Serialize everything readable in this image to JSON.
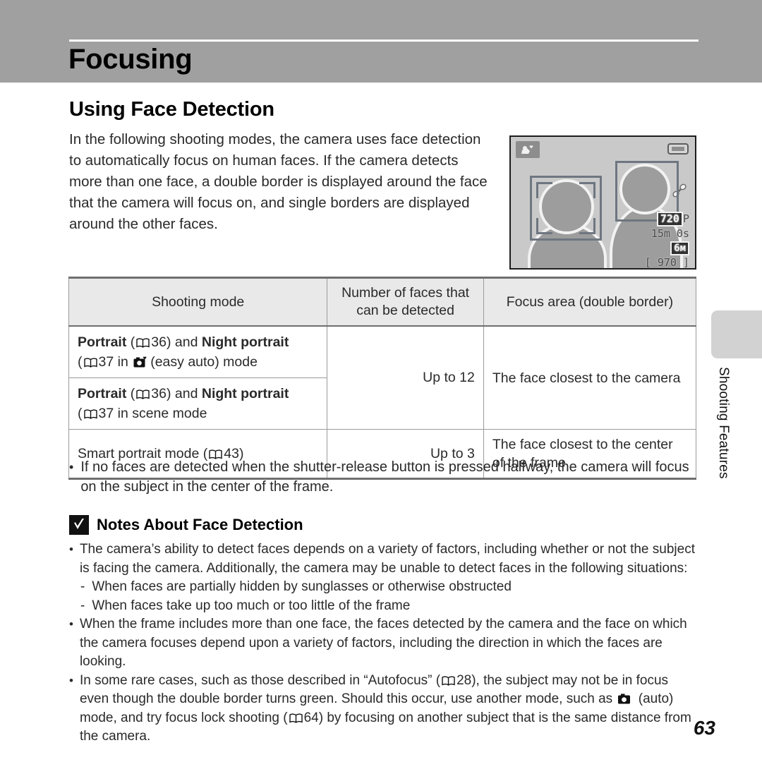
{
  "chapter": {
    "title": "Focusing"
  },
  "section": {
    "title": "Using Face Detection",
    "intro": "In the following shooting modes, the camera uses face detection to automatically focus on human faces. If the camera detects more than one face, a double border is displayed around the face that the camera will focus on, and single borders are displayed around the other faces."
  },
  "lcd": {
    "scene_icon": "night-portrait-scene-icon",
    "battery_icon": "battery-full-icon",
    "vr_icon": "vibration-reduction-icon",
    "movie_mode": "720",
    "movie_mode_suffix": "P",
    "time_remaining": "15m 0s",
    "image_size": "6м",
    "shots_remaining": "[  970 ]",
    "double_border_label": "double-border-focus-area",
    "single_border_label": "single-border-focus-area"
  },
  "table": {
    "headers": {
      "mode": "Shooting mode",
      "number": "Number of faces that can be detected",
      "number_line1": "Number of faces that",
      "number_line2": "can be detected",
      "area": "Focus area (double border)"
    },
    "rows": [
      {
        "mode_bold1": "Portrait",
        "mode_ref1": "36",
        "mode_mid": " and ",
        "mode_bold2": "Night portrait",
        "mode_ref2": "37",
        "mode_tail": " in ",
        "mode_icon": "easy-auto-camera-icon",
        "mode_tail2": "(easy auto) mode",
        "number": "Up to 12",
        "area": "The face closest to the camera"
      },
      {
        "mode_bold1": "Portrait",
        "mode_ref1": "36",
        "mode_mid": " and ",
        "mode_bold2": "Night portrait",
        "mode_ref2": "37",
        "mode_tail": " in scene mode",
        "number": "",
        "area": ""
      },
      {
        "mode_plain": "Smart portrait mode (",
        "mode_ref1": "43",
        "mode_plain_tail": ")",
        "number": "Up to 3",
        "area_line1": "The face closest to the center",
        "area_line2": "of the frame"
      }
    ]
  },
  "bullets_after_table": [
    "If no faces are detected when the shutter-release button is pressed halfway, the camera will focus on the subject in the center of the frame."
  ],
  "notes": {
    "icon": "caution-check-icon",
    "title": "Notes About Face Detection",
    "items": [
      {
        "text": "The camera’s ability to detect faces depends on a variety of factors, including whether or not the subject is facing the camera. Additionally, the camera may be unable to detect faces in the following situations:",
        "sub": [
          "When faces are partially hidden by sunglasses or otherwise obstructed",
          "When faces take up too much or too little of the frame"
        ]
      },
      {
        "text": "When the frame includes more than one face, the faces detected by the camera and the face on which the camera focuses depend upon a variety of factors, including the direction in which the faces are looking.",
        "sub": []
      }
    ],
    "last_item": {
      "part1": "In some rare cases, such as those described in “Autofocus” (",
      "ref1": "28",
      "part2": "), the subject may not be in focus even though the double border turns green. Should this occur, use another mode, such as ",
      "icon": "auto-camera-icon",
      "part3": " (auto) mode, and try focus lock shooting (",
      "ref2": "64",
      "part4": ") by focusing on another subject that is the same distance from the camera."
    }
  },
  "side_tab": {
    "label": "Shooting Features"
  },
  "footer": {
    "page_number": "63"
  },
  "colors": {
    "band": "#a0a0a0",
    "table_header": "#e9e9e9",
    "rule": "#6f6f6f",
    "tab": "#d2d2d2"
  }
}
